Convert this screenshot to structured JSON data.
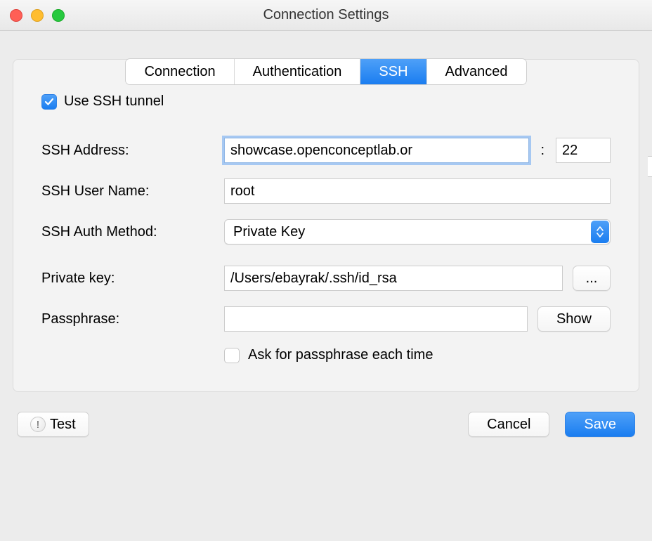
{
  "window": {
    "title": "Connection Settings"
  },
  "tabs": {
    "connection": "Connection",
    "authentication": "Authentication",
    "ssh": "SSH",
    "advanced": "Advanced",
    "active": "ssh"
  },
  "ssh": {
    "use_tunnel_label": "Use SSH tunnel",
    "use_tunnel_checked": true,
    "address_label": "SSH Address:",
    "address_value": "showcase.openconceptlab.or",
    "port_value": "22",
    "username_label": "SSH User Name:",
    "username_value": "root",
    "auth_method_label": "SSH Auth Method:",
    "auth_method_value": "Private Key",
    "private_key_label": "Private key:",
    "private_key_value": "/Users/ebayrak/.ssh/id_rsa",
    "browse_label": "...",
    "passphrase_label": "Passphrase:",
    "passphrase_value": "",
    "show_label": "Show",
    "ask_each_time_label": "Ask for passphrase each time",
    "ask_each_time_checked": false
  },
  "footer": {
    "test_label": "Test",
    "cancel_label": "Cancel",
    "save_label": "Save"
  }
}
